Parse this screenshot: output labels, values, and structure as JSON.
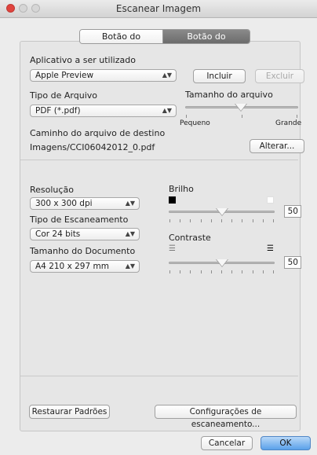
{
  "window": {
    "title": "Escanear Imagem"
  },
  "tabs": {
    "software": "Botão do Software",
    "device": "Botão do Aparelho"
  },
  "app": {
    "label": "Aplicativo a ser utilizado",
    "selected": "Apple Preview",
    "include": "Incluir",
    "delete": "Excluir"
  },
  "filetype": {
    "label": "Tipo de Arquivo",
    "selected": "PDF (*.pdf)"
  },
  "filesize": {
    "label": "Tamanho do arquivo",
    "min_label": "Pequeno",
    "max_label": "Grande",
    "level": 0.5
  },
  "dest": {
    "label": "Caminho do arquivo de destino",
    "path": "Imagens/CCI06042012_0.pdf",
    "change": "Alterar..."
  },
  "resolution": {
    "label": "Resolução",
    "selected": "300 x 300 dpi"
  },
  "scantype": {
    "label": "Tipo de Escaneamento",
    "selected": "Cor 24 bits"
  },
  "docsize": {
    "label": "Tamanho do Documento",
    "selected": "A4 210 x 297 mm"
  },
  "brightness": {
    "label": "Brilho",
    "value": "50"
  },
  "contrast": {
    "label": "Contraste",
    "value": "50"
  },
  "buttons": {
    "restore": "Restaurar Padrões",
    "scan_settings": "Configurações de escaneamento...",
    "cancel": "Cancelar",
    "ok": "OK"
  },
  "colors": {
    "close": "#e0443e",
    "default_button": "#5aa1ea",
    "selected_tab": "#7a7a7a"
  }
}
